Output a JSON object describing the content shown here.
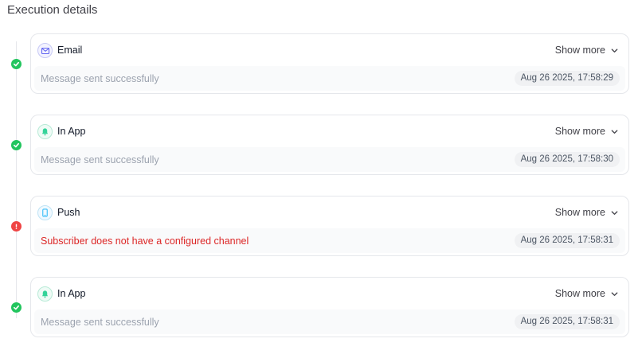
{
  "section_title": "Execution details",
  "show_more_label": "Show more",
  "steps": [
    {
      "channel": "Email",
      "icon": "email-icon",
      "status": "success",
      "message": "Message sent successfully",
      "timestamp": "Aug 26 2025, 17:58:29"
    },
    {
      "channel": "In App",
      "icon": "bell-icon",
      "status": "success",
      "message": "Message sent successfully",
      "timestamp": "Aug 26 2025, 17:58:30"
    },
    {
      "channel": "Push",
      "icon": "mobile-icon",
      "status": "error",
      "message": "Subscriber does not have a configured channel",
      "timestamp": "Aug 26 2025, 17:58:31"
    },
    {
      "channel": "In App",
      "icon": "bell-icon",
      "status": "success",
      "message": "Message sent successfully",
      "timestamp": "Aug 26 2025, 17:58:31"
    }
  ],
  "colors": {
    "success": "#22c55e",
    "error": "#ef4444",
    "error_text": "#dc2626"
  }
}
